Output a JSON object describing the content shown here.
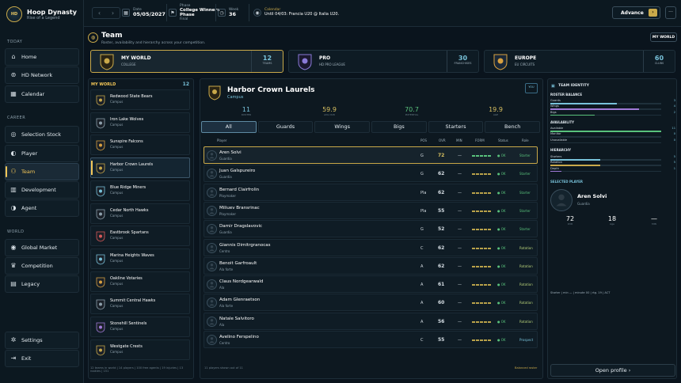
{
  "brand": {
    "logo_text": "HD",
    "title": "Hoop Dynasty",
    "subtitle": "Rise of a Legend"
  },
  "sidebar": {
    "sections": {
      "today": "TODAY",
      "career": "CAREER",
      "world": "WORLD"
    },
    "today": [
      {
        "label": "Home",
        "icon": "home-icon"
      },
      {
        "label": "HD Network",
        "icon": "network-icon"
      },
      {
        "label": "Calendar",
        "icon": "calendar-icon"
      }
    ],
    "career": [
      {
        "label": "Selection Stock",
        "icon": "target-icon"
      },
      {
        "label": "Player",
        "icon": "player-icon"
      },
      {
        "label": "Team",
        "icon": "team-icon",
        "active": true
      },
      {
        "label": "Development",
        "icon": "chart-icon"
      },
      {
        "label": "Agent",
        "icon": "agent-icon"
      }
    ],
    "world": [
      {
        "label": "Global Market",
        "icon": "globe-icon"
      },
      {
        "label": "Competition",
        "icon": "trophy-icon"
      },
      {
        "label": "Legacy",
        "icon": "building-icon"
      }
    ],
    "bottom": [
      {
        "label": "Settings",
        "icon": "gear-icon"
      },
      {
        "label": "Exit",
        "icon": "exit-icon"
      }
    ]
  },
  "topbar": {
    "date_label": "Date",
    "date": "05/05/2027",
    "phase_label": "Phase",
    "phase": "College Winners Phase",
    "phase_sub": "Final",
    "week_label": "Week",
    "week": "36",
    "calendar_label": "Calendar",
    "calendar_text": "Until 04/03: Francia U20 @ Italia U20.",
    "advance": "Advance",
    "more": "···"
  },
  "header": {
    "title": "Team",
    "subtitle": "Roster, availability and hierarchy across your competition.",
    "world_button": "MY WORLD"
  },
  "levels": [
    {
      "name": "MY WORLD",
      "sub": "COLLEGE",
      "num": "12",
      "num_label": "TEAMS",
      "selected": true
    },
    {
      "name": "PRO",
      "sub": "HD PRO LEAGUE",
      "num": "30",
      "num_label": "FRANCHISES"
    },
    {
      "name": "EUROPE",
      "sub": "EU CIRCUITS",
      "num": "60",
      "num_label": "CLUBS"
    }
  ],
  "left": {
    "title": "MY WORLD",
    "count": "12",
    "teams": [
      {
        "name": "Redwood State Bears",
        "conf": "Campus"
      },
      {
        "name": "Iron Lake Wolves",
        "conf": "Campus"
      },
      {
        "name": "Sunspire Falcons",
        "conf": "Campus"
      },
      {
        "name": "Harbor Crown Laurels",
        "conf": "Campus",
        "selected": true
      },
      {
        "name": "Blue Ridge Miners",
        "conf": "Campus"
      },
      {
        "name": "Cedar North Hawks",
        "conf": "Campus"
      },
      {
        "name": "Eastbrook Spartans",
        "conf": "Campus"
      },
      {
        "name": "Marina Heights Waves",
        "conf": "Campus"
      },
      {
        "name": "Oakline Votaries",
        "conf": "Campus"
      },
      {
        "name": "Summit Central Hawks",
        "conf": "Campus"
      },
      {
        "name": "Stonehill Sentinels",
        "conf": "Campus"
      },
      {
        "name": "Westgate Crests",
        "conf": "Campus"
      }
    ],
    "footer": "12 teams in world | 14 players | 100 free agents | 19 injuries | 13 rookies | 151"
  },
  "center": {
    "team": "Harbor Crown Laurels",
    "conf": "Campus",
    "you_badge": "YOU",
    "stats": [
      {
        "value": "11",
        "label": "ROSTER"
      },
      {
        "value": "59.9",
        "label": "AVG OVR"
      },
      {
        "value": "70.7",
        "label": "POTENTIAL"
      },
      {
        "value": "19.9",
        "label": "AGE"
      }
    ],
    "tabs": [
      "All",
      "Guards",
      "Wings",
      "Bigs",
      "Starters",
      "Bench"
    ],
    "columns": {
      "player": "Player",
      "pos": "POS",
      "ovr": "OVR",
      "min": "MIN",
      "form": "FORM",
      "status": "Status",
      "role": "Role"
    },
    "players": [
      {
        "name": "Aren Solvi",
        "pos_full": "Guardia",
        "pos": "G",
        "ovr": "72",
        "min": "—",
        "status": "● OK",
        "role": "Starter",
        "form": [
          1,
          1,
          1,
          1,
          1
        ],
        "selected": true
      },
      {
        "name": "Juan Galspureiro",
        "pos_full": "Guardia",
        "pos": "G",
        "ovr": "62",
        "min": "—",
        "status": "● OK",
        "role": "Starter",
        "form": [
          0,
          0,
          0,
          0,
          0
        ]
      },
      {
        "name": "Bernard Clairfrolin",
        "pos_full": "Playmaker",
        "pos": "Pla",
        "ovr": "62",
        "min": "—",
        "status": "● OK",
        "role": "Starter",
        "form": [
          0,
          0,
          0,
          0,
          0
        ]
      },
      {
        "name": "Miliuev Bransrinac",
        "pos_full": "Playmaker",
        "pos": "Pla",
        "ovr": "55",
        "min": "—",
        "status": "● OK",
        "role": "Starter",
        "form": [
          0,
          0,
          0,
          0,
          0
        ]
      },
      {
        "name": "Damir Dragslavovic",
        "pos_full": "Guardia",
        "pos": "G",
        "ovr": "52",
        "min": "—",
        "status": "● OK",
        "role": "Starter",
        "form": [
          0,
          0,
          0,
          0,
          0
        ]
      },
      {
        "name": "Giannis Dimitrgranocas",
        "pos_full": "Centro",
        "pos": "C",
        "ovr": "62",
        "min": "—",
        "status": "● OK",
        "role": "Rotation",
        "form": [
          0,
          0,
          0,
          0,
          0
        ]
      },
      {
        "name": "Benoit Garfroault",
        "pos_full": "Ala forte",
        "pos": "A",
        "ovr": "62",
        "min": "—",
        "status": "● OK",
        "role": "Rotation",
        "form": [
          0,
          0,
          0,
          0,
          0
        ]
      },
      {
        "name": "Claus Nordgearwald",
        "pos_full": "Ala",
        "pos": "A",
        "ovr": "61",
        "min": "—",
        "status": "● OK",
        "role": "Rotation",
        "form": [
          0,
          0,
          0,
          0,
          0
        ]
      },
      {
        "name": "Adam Glenraetson",
        "pos_full": "Ala forte",
        "pos": "A",
        "ovr": "60",
        "min": "—",
        "status": "● OK",
        "role": "Rotation",
        "form": [
          0,
          0,
          0,
          0,
          0
        ]
      },
      {
        "name": "Natale Salvitoro",
        "pos_full": "Ala",
        "pos": "A",
        "ovr": "56",
        "min": "—",
        "status": "● OK",
        "role": "Rotation",
        "form": [
          0,
          0,
          0,
          0,
          0
        ]
      },
      {
        "name": "Avelino Ferspelino",
        "pos_full": "Centro",
        "pos": "C",
        "ovr": "55",
        "min": "—",
        "status": "● OK",
        "role": "Prospect",
        "form": [
          0,
          0,
          0,
          0,
          0
        ]
      }
    ],
    "footer_left": "11 players shown out of 11",
    "footer_right": "Balanced roster"
  },
  "right": {
    "title": "TEAM IDENTITY",
    "balance_label": "ROSTER BALANCE",
    "balance": [
      {
        "label": "Guards",
        "value": "3",
        "pct": 0.6,
        "color": "#78c2da"
      },
      {
        "label": "Wings",
        "value": "4",
        "pct": 0.8,
        "color": "#a07ad8"
      },
      {
        "label": "Bigs",
        "value": "2",
        "pct": 0.4,
        "color": "#59c27c"
      }
    ],
    "avail_label": "AVAILABILITY",
    "availability": [
      {
        "label": "Available",
        "value": "11",
        "pct": 1.0,
        "color": "#59c27c"
      },
      {
        "label": "Monitor",
        "value": "0",
        "pct": 0.0,
        "color": "#c9a94a"
      },
      {
        "label": "Unavailable",
        "value": "0",
        "pct": 0.0,
        "color": "#d85959"
      }
    ],
    "hier_label": "HIERARCHY",
    "hierarchy": [
      {
        "label": "Starters",
        "value": "5",
        "pct": 0.45,
        "color": "#78c2da"
      },
      {
        "label": "Rotation",
        "value": "5",
        "pct": 0.45,
        "color": "#c9a94a"
      },
      {
        "label": "Depth",
        "value": "1",
        "pct": 0.1,
        "color": "#a07ad8"
      }
    ],
    "selected_label": "SELECTED PLAYER",
    "player": {
      "name": "Aren Solvi",
      "role": "Guardia"
    },
    "pstats": [
      {
        "value": "72",
        "label": "OVR"
      },
      {
        "value": "18",
        "label": "Age"
      },
      {
        "value": "—",
        "label": "MIN"
      }
    ],
    "note": "Starter | min — | minute 00 | rtg. 19 | ACT",
    "open": "Open profile ›"
  }
}
